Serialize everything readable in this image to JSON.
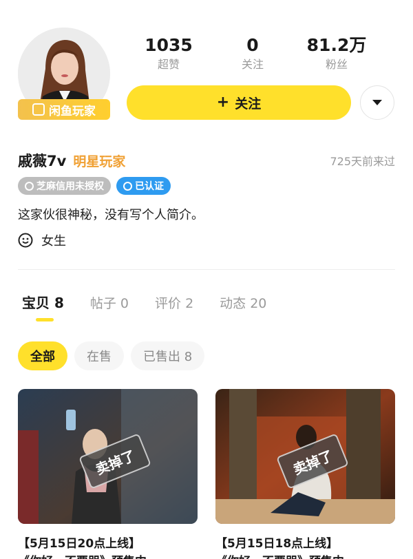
{
  "profile": {
    "player_badge": "闲鱼玩家",
    "nickname": "戚薇7v",
    "title_tag": "明星玩家",
    "last_seen": "725天前来过",
    "badges": [
      {
        "label": "芝麻信用未授权"
      },
      {
        "label": "已认证"
      }
    ],
    "bio": "这家伙很神秘，没有写个人简介。",
    "gender": "女生"
  },
  "stats": [
    {
      "value": "1035",
      "label": "超赞"
    },
    {
      "value": "0",
      "label": "关注"
    },
    {
      "value": "81.2万",
      "label": "粉丝"
    }
  ],
  "actions": {
    "follow_plus": "+",
    "follow_label": "关注"
  },
  "tabs": [
    {
      "label": "宝贝 8",
      "active": true
    },
    {
      "label": "帖子 0",
      "active": false
    },
    {
      "label": "评价 2",
      "active": false
    },
    {
      "label": "动态 20",
      "active": false
    }
  ],
  "filters": [
    {
      "label": "全部",
      "active": true
    },
    {
      "label": "在售",
      "active": false
    },
    {
      "label": "已售出 8",
      "active": false
    }
  ],
  "items": [
    {
      "title": "【5月15日20点上线】",
      "subtitle": "《你好，不要哭》预售中",
      "stamp": "卖掉了"
    },
    {
      "title": "【5月15日18点上线】",
      "subtitle": "《你好，不要哭》预售中",
      "stamp": "卖掉了"
    }
  ],
  "colors": {
    "accent_yellow": "#ffe02b",
    "orange_title": "#f0a033",
    "verified_blue": "#2e9bf0",
    "muted_gray": "#9a9a9a"
  },
  "icons": {
    "more": "caret-down-icon",
    "gender": "smiley-icon"
  }
}
